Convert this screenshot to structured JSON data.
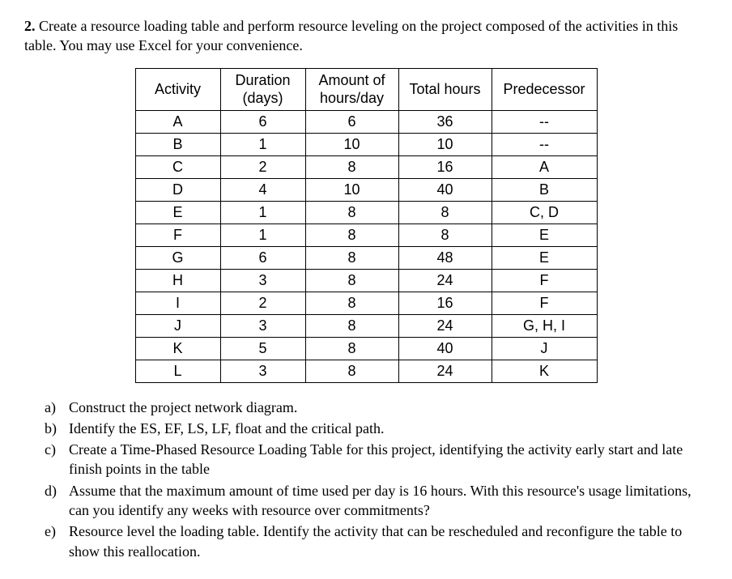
{
  "intro": {
    "number": "2.",
    "text": "Create a resource loading table and perform resource leveling on the project composed of the activities in this table. You may use Excel for your convenience."
  },
  "table": {
    "headers": {
      "activity": "Activity",
      "duration": "Duration (days)",
      "amount": "Amount of hours/day",
      "total": "Total hours",
      "predecessor": "Predecessor"
    },
    "rows": [
      {
        "activity": "A",
        "duration": "6",
        "amount": "6",
        "total": "36",
        "predecessor": "--"
      },
      {
        "activity": "B",
        "duration": "1",
        "amount": "10",
        "total": "10",
        "predecessor": "--"
      },
      {
        "activity": "C",
        "duration": "2",
        "amount": "8",
        "total": "16",
        "predecessor": "A"
      },
      {
        "activity": "D",
        "duration": "4",
        "amount": "10",
        "total": "40",
        "predecessor": "B"
      },
      {
        "activity": "E",
        "duration": "1",
        "amount": "8",
        "total": "8",
        "predecessor": "C, D"
      },
      {
        "activity": "F",
        "duration": "1",
        "amount": "8",
        "total": "8",
        "predecessor": "E"
      },
      {
        "activity": "G",
        "duration": "6",
        "amount": "8",
        "total": "48",
        "predecessor": "E"
      },
      {
        "activity": "H",
        "duration": "3",
        "amount": "8",
        "total": "24",
        "predecessor": "F"
      },
      {
        "activity": "I",
        "duration": "2",
        "amount": "8",
        "total": "16",
        "predecessor": "F"
      },
      {
        "activity": "J",
        "duration": "3",
        "amount": "8",
        "total": "24",
        "predecessor": "G, H, I"
      },
      {
        "activity": "K",
        "duration": "5",
        "amount": "8",
        "total": "40",
        "predecessor": "J"
      },
      {
        "activity": "L",
        "duration": "3",
        "amount": "8",
        "total": "24",
        "predecessor": "K"
      }
    ]
  },
  "questions": [
    {
      "letter": "a)",
      "text": "Construct the project network diagram."
    },
    {
      "letter": "b)",
      "text": "Identify the ES, EF, LS, LF, float and the critical path."
    },
    {
      "letter": "c)",
      "text": "Create a Time-Phased Resource Loading Table for this project, identifying the activity early start and late finish points in the table"
    },
    {
      "letter": "d)",
      "text": "Assume that the maximum amount of time used per day is 16 hours. With this resource's usage limitations, can you identify any weeks with resource over commitments?"
    },
    {
      "letter": "e)",
      "text": "Resource level the loading table.  Identify the activity that can be rescheduled and reconfigure the table to show this reallocation."
    }
  ]
}
